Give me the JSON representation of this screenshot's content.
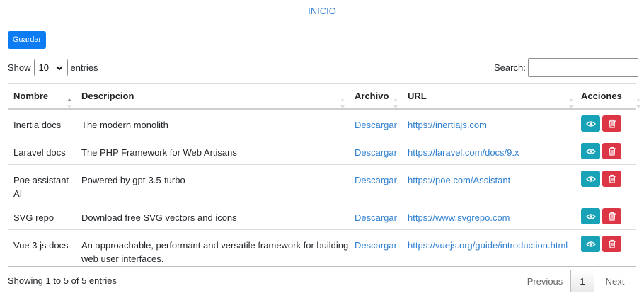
{
  "nav": {
    "inicio": "INICIO"
  },
  "toolbar": {
    "save_label": "Guardar"
  },
  "length": {
    "show": "Show",
    "value": "10",
    "entries": "entries"
  },
  "search": {
    "label": "Search:",
    "value": ""
  },
  "table": {
    "headers": [
      "Nombre",
      "Descripcion",
      "Archivo",
      "URL",
      "Acciones"
    ],
    "rows": [
      {
        "nombre": "Inertia docs",
        "descripcion": "The modern monolith",
        "archivo": "Descargar",
        "url": "https://inertiajs.com"
      },
      {
        "nombre": "Laravel docs",
        "descripcion": "The PHP Framework for Web Artisans",
        "archivo": "Descargar",
        "url": "https://laravel.com/docs/9.x"
      },
      {
        "nombre": "Poe assistant AI",
        "descripcion": "Powered by gpt-3.5-turbo",
        "archivo": "Descargar",
        "url": "https://poe.com/Assistant"
      },
      {
        "nombre": "SVG repo",
        "descripcion": "Download free SVG vectors and icons",
        "archivo": "Descargar",
        "url": "https://www.svgrepo.com"
      },
      {
        "nombre": "Vue 3 js docs",
        "descripcion": "An approachable, performant and versatile framework for building web user interfaces.",
        "archivo": "Descargar",
        "url": "https://vuejs.org/guide/introduction.html"
      }
    ]
  },
  "footer": {
    "info": "Showing 1 to 5 of 5 entries"
  },
  "pagination": {
    "previous": "Previous",
    "page": "1",
    "next": "Next"
  },
  "colors": {
    "primary": "#0d7cf2",
    "link": "#2f80d1",
    "view": "#17a2b8",
    "delete": "#dc3545"
  },
  "icons": {
    "view": "eye-icon",
    "delete": "trash-icon",
    "sort": "sort-icon",
    "select": "chevron-down-icon"
  }
}
